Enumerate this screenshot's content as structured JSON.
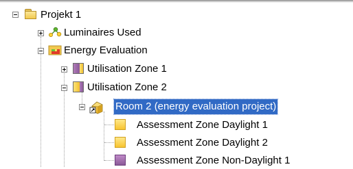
{
  "tree": {
    "project": {
      "label": "Projekt 1",
      "expanded": true,
      "icon": "folder-icon"
    },
    "luminaires": {
      "label": "Luminaires Used",
      "expanded": false,
      "icon": "luminaires-icon"
    },
    "energy": {
      "label": "Energy Evaluation",
      "expanded": true,
      "icon": "energy-evaluation-icon"
    },
    "zone1": {
      "label": "Utilisation Zone 1",
      "expanded": false,
      "icon": "utilisation-zone-icon"
    },
    "zone2": {
      "label": "Utilisation Zone 2",
      "expanded": true,
      "icon": "utilisation-zone-icon"
    },
    "room2": {
      "label": "Room 2 (energy evaluation project)",
      "expanded": true,
      "selected": true,
      "icon": "room-icon"
    },
    "assessments": [
      {
        "label": "Assessment Zone Daylight 1",
        "icon": "daylight-zone-icon",
        "color": "#fdd84a"
      },
      {
        "label": "Assessment Zone Daylight 2",
        "icon": "daylight-zone-icon",
        "color": "#fdd84a"
      },
      {
        "label": "Assessment Zone Non-Daylight 1",
        "icon": "non-daylight-zone-icon",
        "color": "#a06ea8"
      }
    ]
  },
  "colors": {
    "selection": "#316ac5",
    "zone_yellow": "#fccd3c",
    "zone_purple": "#a06ea8"
  }
}
